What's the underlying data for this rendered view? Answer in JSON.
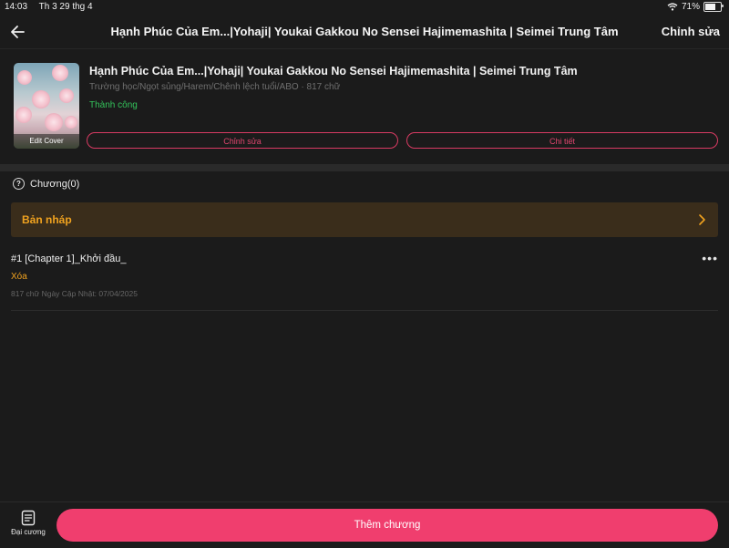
{
  "status_bar": {
    "time": "14:03",
    "date": "Th 3 29 thg 4",
    "battery": "71%",
    "battery_level": 0.71
  },
  "header": {
    "title": "Hạnh Phúc Của Em...|Yohaji| Youkai Gakkou No Sensei Hajimemashita | Seimei Trung Tâm",
    "edit_label": "Chỉnh sửa"
  },
  "book": {
    "cover_caption": "Edit Cover",
    "title": "Hạnh Phúc Của Em...|Yohaji| Youkai Gakkou No Sensei Hajimemashita | Seimei Trung Tâm",
    "meta": "Trường học/Ngọt sủng/Harem/Chênh lệch tuổi/ABO · 817 chữ",
    "status": "Thành công",
    "edit_button": "Chỉnh sửa",
    "detail_button": "Chi tiết"
  },
  "chapters": {
    "header": "Chương(0)",
    "draft_label": "Bản nháp",
    "items": [
      {
        "title": "#1 [Chapter 1]_Khởi đầu_",
        "delete_label": "Xóa",
        "info": "817 chữ Ngày Cập Nhật: 07/04/2025"
      }
    ]
  },
  "bottom": {
    "outline_label": "Đại cương",
    "add_chapter": "Thêm chương"
  },
  "colors": {
    "accent": "#f03e6e",
    "draft_bg": "#3a2d1b",
    "draft_text": "#f0a21f",
    "success": "#33c25a"
  }
}
